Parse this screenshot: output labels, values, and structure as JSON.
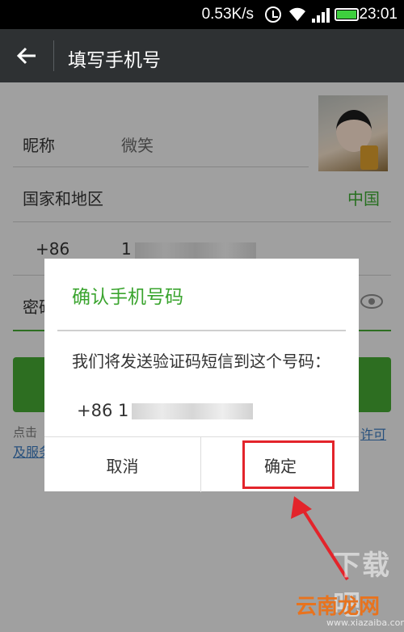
{
  "status_bar": {
    "speed": "0.53K/s",
    "time": "23:01",
    "icons": [
      "alarm-icon",
      "wifi-icon",
      "signal-icon",
      "battery-icon"
    ]
  },
  "header": {
    "title": "填写手机号",
    "back_icon": "back-arrow-icon"
  },
  "form": {
    "nickname_label": "昵称",
    "nickname_value": "微笑",
    "country_label": "国家和地区",
    "country_value": "中国",
    "phone_prefix": "+86",
    "phone_visible": "1",
    "password_label_partial": "密码",
    "agree_prefix": "点击",
    "agree_link_right": "许可",
    "agree_link_left": "及服务"
  },
  "dialog": {
    "title": "确认手机号码",
    "message": "我们将发送验证码短信到这个号码：",
    "phone_prefix": "+86",
    "phone_visible": "1",
    "cancel_label": "取消",
    "confirm_label": "确定"
  },
  "watermark": {
    "line1": "下载吧",
    "brand": "云南龙网",
    "url": "www.xiazaiba.com"
  },
  "colors": {
    "accent_green": "#3aa42e",
    "titlebar": "#2e3133",
    "highlight_red": "#e3242b"
  }
}
